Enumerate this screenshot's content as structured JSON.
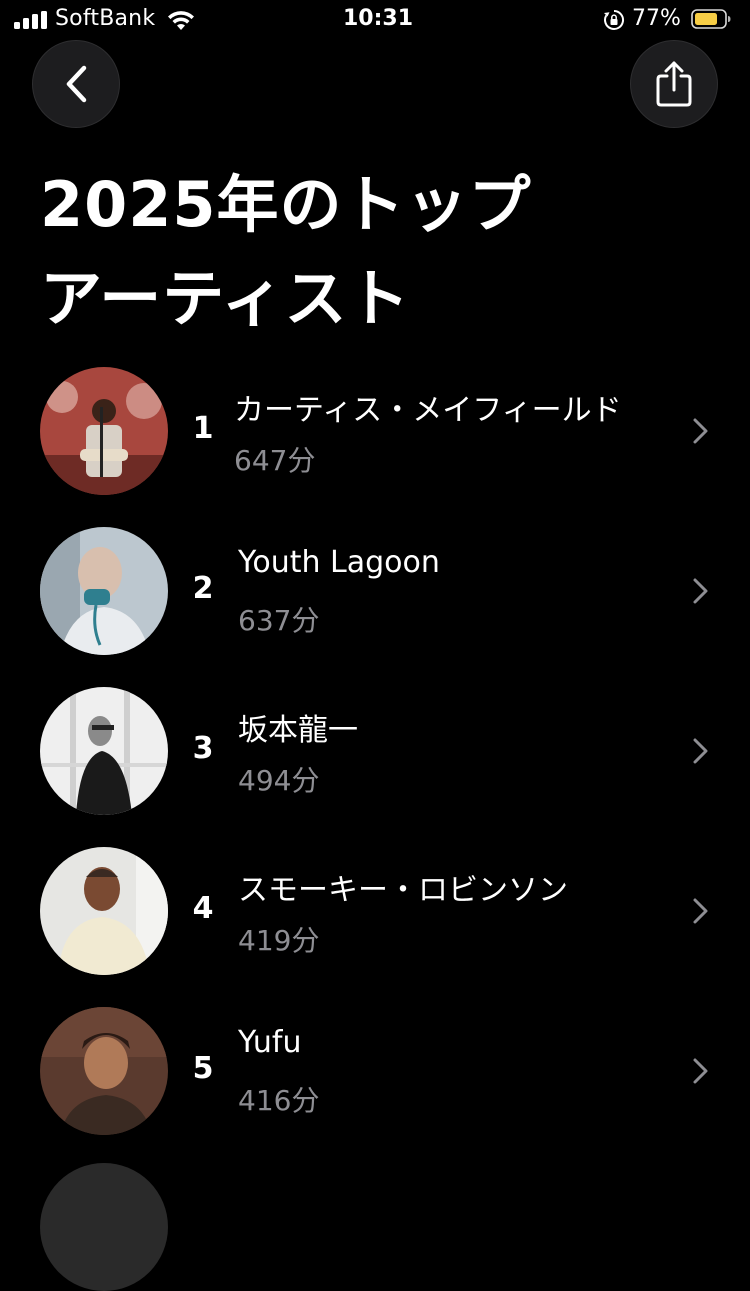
{
  "status_bar": {
    "carrier": "SoftBank",
    "time": "10:31",
    "battery_percent": "77%",
    "battery_color": "#f7ce46",
    "icons": [
      "cellular-signal-icon",
      "wifi-icon",
      "rotation-lock-icon",
      "battery-icon"
    ]
  },
  "header": {
    "back_icon": "chevron-left-icon",
    "share_icon": "share-icon"
  },
  "title": {
    "line1": "2025年のトップ",
    "line2": "アーティスト"
  },
  "artists": [
    {
      "rank": "1",
      "name": "カーティス・メイフィールド",
      "minutes": "647分"
    },
    {
      "rank": "2",
      "name": "Youth Lagoon",
      "minutes": "637分"
    },
    {
      "rank": "3",
      "name": "坂本龍一",
      "minutes": "494分"
    },
    {
      "rank": "4",
      "name": "スモーキー・ロビンソン",
      "minutes": "419分"
    },
    {
      "rank": "5",
      "name": "Yufu",
      "minutes": "416分"
    }
  ],
  "colors": {
    "background": "#000000",
    "secondary_text": "#8e8e93",
    "chevron": "#8e8e93"
  }
}
